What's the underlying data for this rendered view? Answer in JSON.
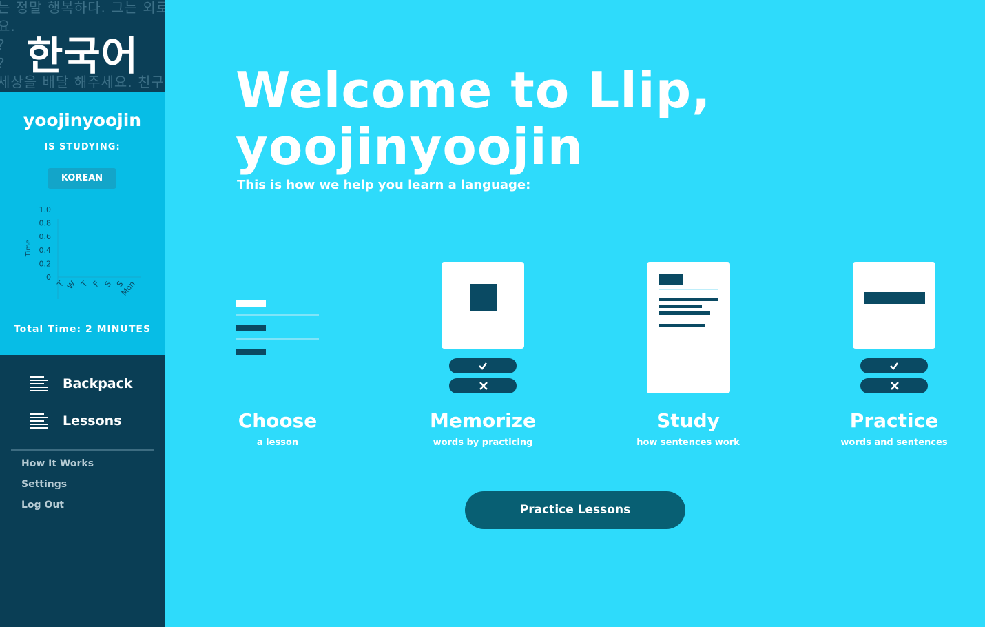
{
  "sidebar": {
    "logo": {
      "text": "한국어",
      "background_text": "는 정말 행복하다. 그는 외로\n요.                              매\n?                                 재\n?                                 맨\n세상을 배달 해주세요. 친구들"
    },
    "profile": {
      "username": "yoojinyoojin",
      "studying_label": "IS STUDYING:",
      "language": "KOREAN",
      "total_time": "Total Time: 2 MINUTES"
    },
    "nav": {
      "backpack": "Backpack",
      "lessons": "Lessons"
    },
    "links": {
      "how_it_works": "How It Works",
      "settings": "Settings",
      "log_out": "Log Out"
    }
  },
  "main": {
    "welcome_line1": "Welcome to Llip,",
    "welcome_line2": "yoojinyoojin",
    "subtitle": "This is how we help you learn a language:",
    "steps": [
      {
        "title": "Choose",
        "desc": "a lesson",
        "icon": "lesson-list-icon"
      },
      {
        "title": "Memorize",
        "desc": "words by practicing",
        "icon": "flashcard-icon"
      },
      {
        "title": "Study",
        "desc": "how sentences work",
        "icon": "document-icon"
      },
      {
        "title": "Practice",
        "desc": "words and sentences",
        "icon": "sentence-card-icon"
      }
    ],
    "cta": "Practice Lessons"
  },
  "colors": {
    "main_bg": "#2edbfb",
    "sidebar_dark": "#0a3e55",
    "profile_bg": "#07bde6",
    "accent_dark": "#0a4a63",
    "button": "#085f73",
    "white": "#ffffff"
  },
  "chart_data": {
    "type": "bar",
    "categories": [
      "T",
      "W",
      "T",
      "F",
      "S",
      "S",
      "Mon"
    ],
    "values": [
      0,
      0,
      0,
      0,
      0,
      0,
      0
    ],
    "ylabel": "Time",
    "ylim": [
      0,
      1.0
    ],
    "yticks": [
      "1.0",
      "0.8",
      "0.6",
      "0.4",
      "0.2",
      "0"
    ]
  }
}
